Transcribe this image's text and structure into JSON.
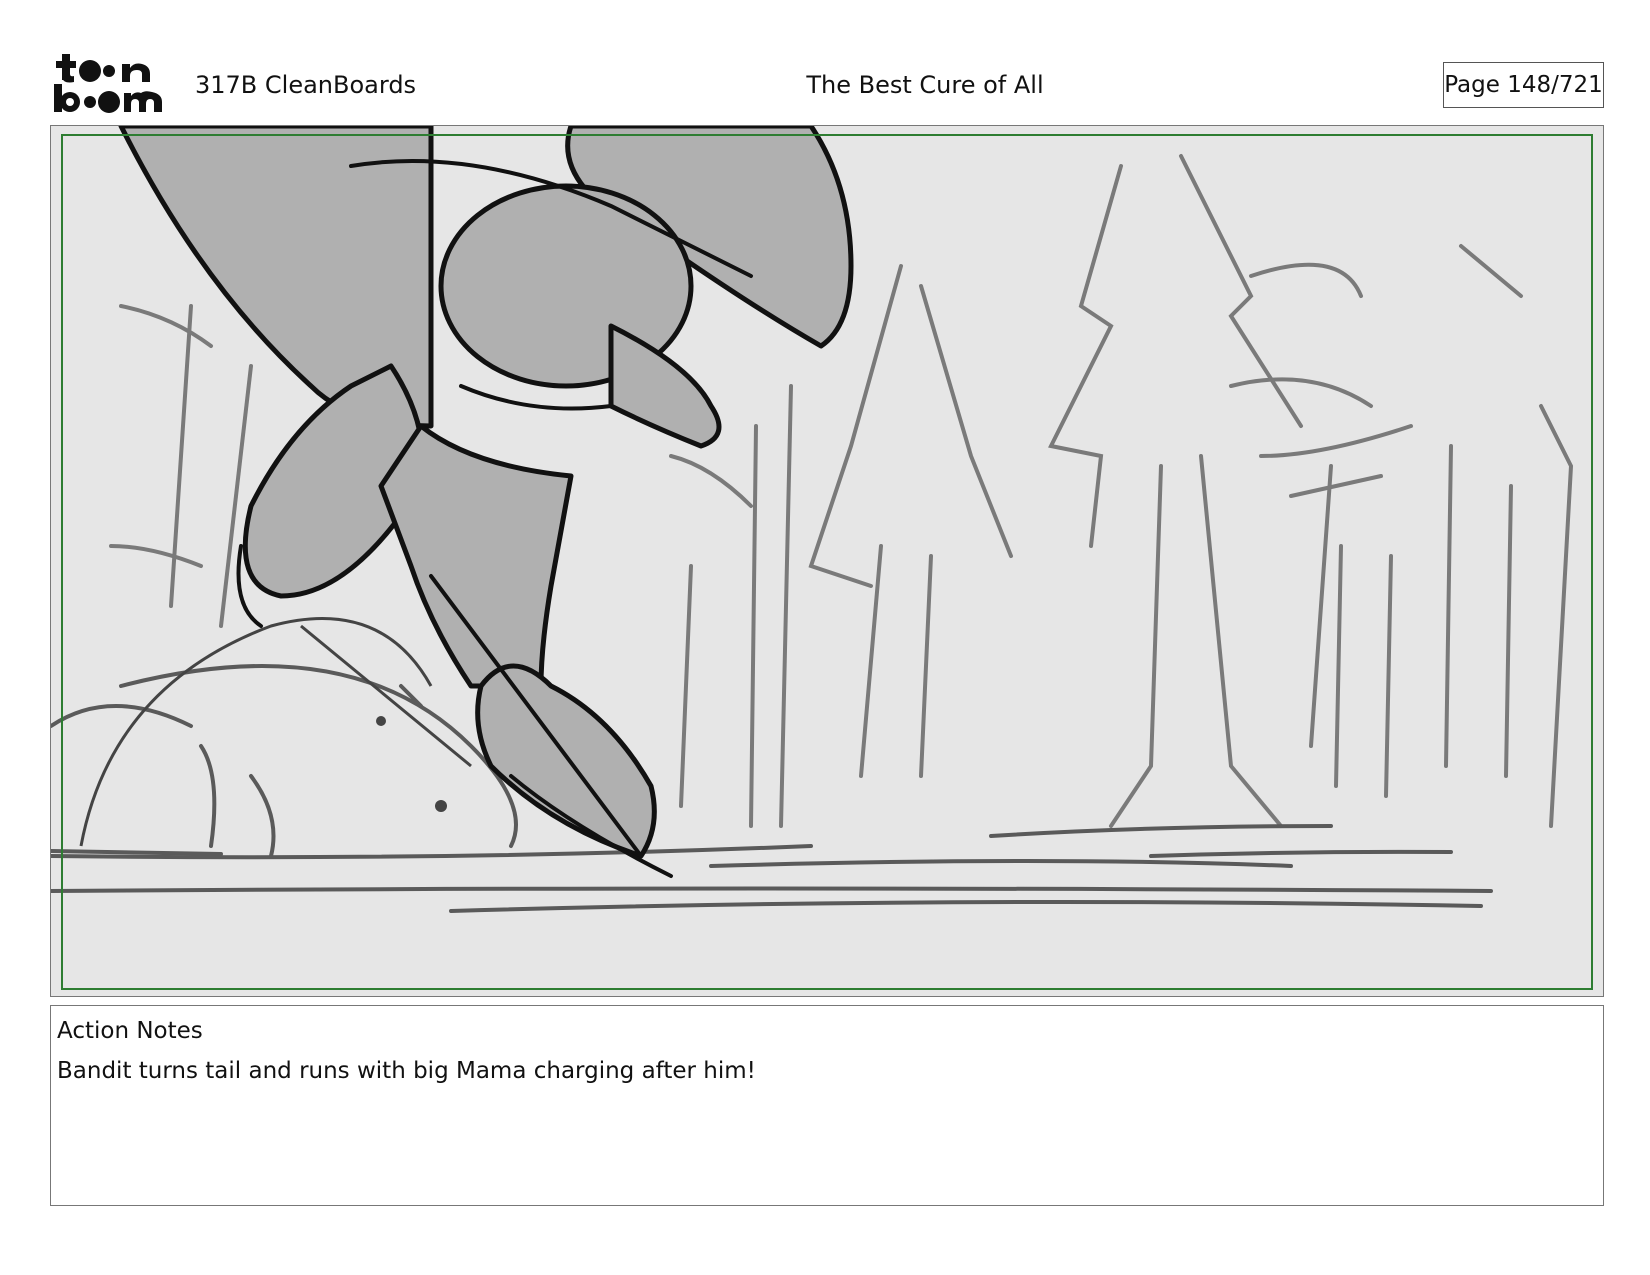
{
  "header": {
    "logo_text": "toon boom",
    "scene_id": "317B  CleanBoards",
    "title": "The Best Cure of All",
    "page": "Page 148/721"
  },
  "panel": {
    "image": "storyboard-sketch",
    "safe_frame_color": "#2e7d32",
    "background_color": "#e6e6e6"
  },
  "notes": {
    "label": "Action Notes",
    "text": "Bandit turns tail and runs with big Mama charging after him!"
  }
}
